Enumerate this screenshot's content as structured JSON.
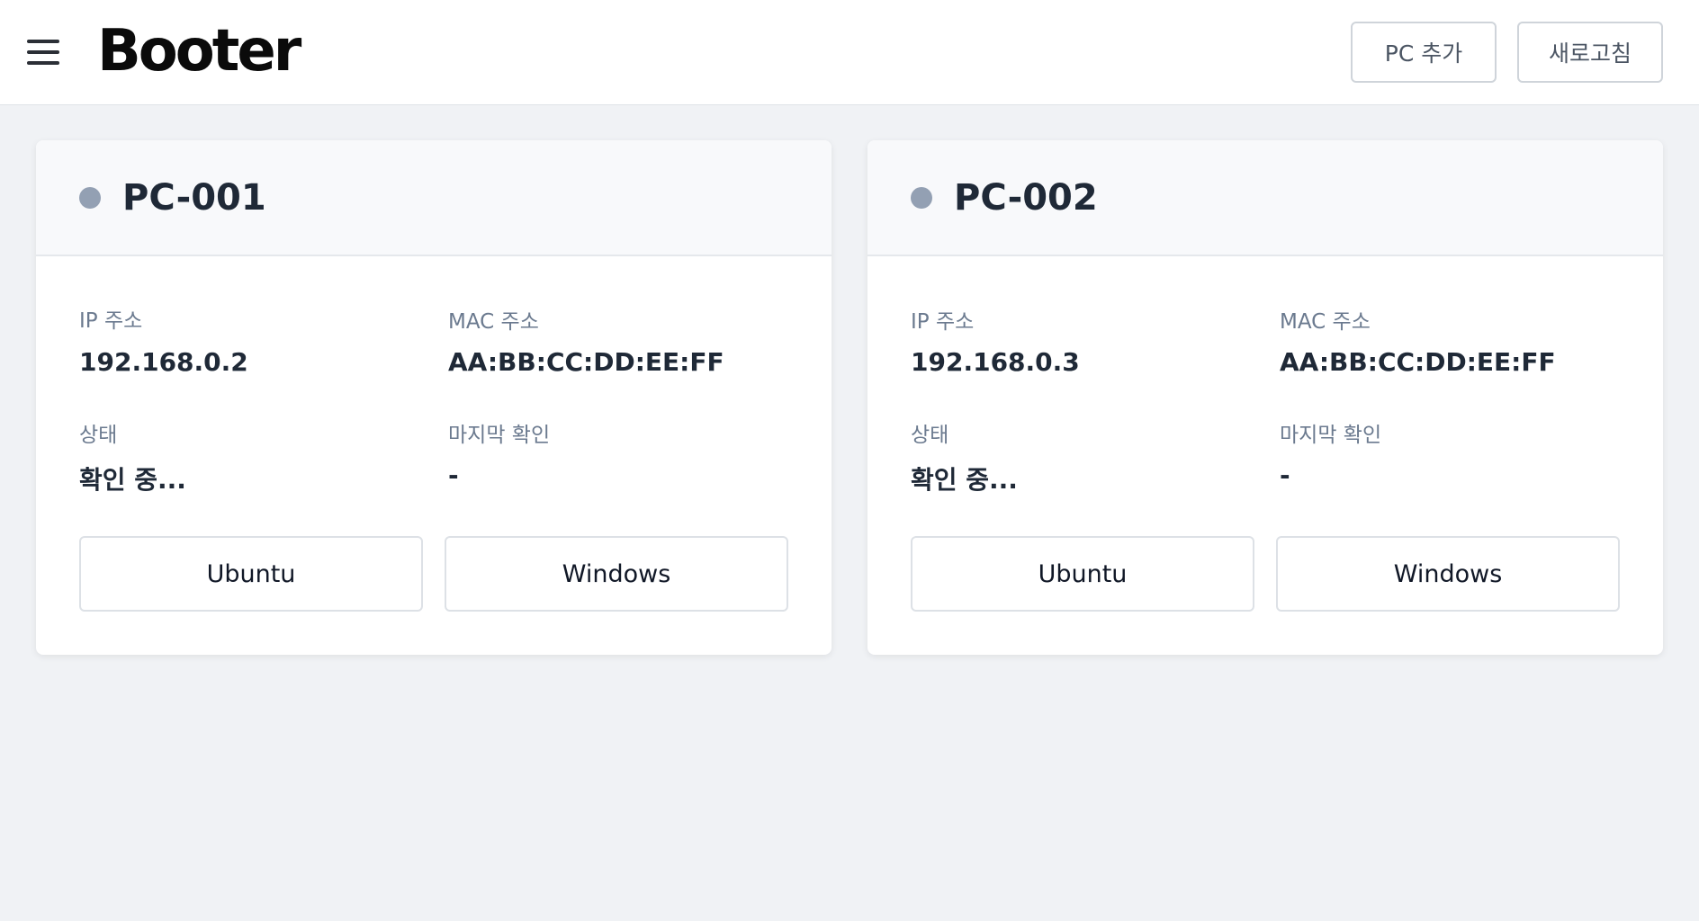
{
  "header": {
    "logo_text": "Booter",
    "add_pc_label": "PC 추가",
    "refresh_label": "새로고침"
  },
  "colors": {
    "background": "#f0f2f5",
    "status_unknown": "#93a0b3"
  },
  "labels": {
    "ip": "IP 주소",
    "mac": "MAC 주소",
    "status": "상태",
    "last_checked": "마지막 확인"
  },
  "pcs": [
    {
      "name": "PC-001",
      "ip": "192.168.0.2",
      "mac": "AA:BB:CC:DD:EE:FF",
      "status": "확인 중...",
      "last_checked": "-",
      "buttons": [
        "Ubuntu",
        "Windows"
      ]
    },
    {
      "name": "PC-002",
      "ip": "192.168.0.3",
      "mac": "AA:BB:CC:DD:EE:FF",
      "status": "확인 중...",
      "last_checked": "-",
      "buttons": [
        "Ubuntu",
        "Windows"
      ]
    }
  ]
}
